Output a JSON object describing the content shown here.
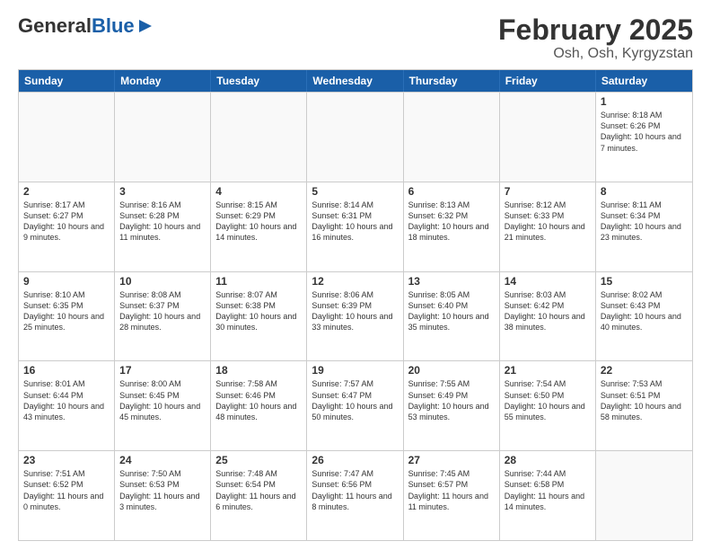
{
  "logo": {
    "general": "General",
    "blue": "Blue"
  },
  "title": "February 2025",
  "subtitle": "Osh, Osh, Kyrgyzstan",
  "weekdays": [
    "Sunday",
    "Monday",
    "Tuesday",
    "Wednesday",
    "Thursday",
    "Friday",
    "Saturday"
  ],
  "weeks": [
    [
      {
        "day": "",
        "info": ""
      },
      {
        "day": "",
        "info": ""
      },
      {
        "day": "",
        "info": ""
      },
      {
        "day": "",
        "info": ""
      },
      {
        "day": "",
        "info": ""
      },
      {
        "day": "",
        "info": ""
      },
      {
        "day": "1",
        "info": "Sunrise: 8:18 AM\nSunset: 6:26 PM\nDaylight: 10 hours and 7 minutes."
      }
    ],
    [
      {
        "day": "2",
        "info": "Sunrise: 8:17 AM\nSunset: 6:27 PM\nDaylight: 10 hours and 9 minutes."
      },
      {
        "day": "3",
        "info": "Sunrise: 8:16 AM\nSunset: 6:28 PM\nDaylight: 10 hours and 11 minutes."
      },
      {
        "day": "4",
        "info": "Sunrise: 8:15 AM\nSunset: 6:29 PM\nDaylight: 10 hours and 14 minutes."
      },
      {
        "day": "5",
        "info": "Sunrise: 8:14 AM\nSunset: 6:31 PM\nDaylight: 10 hours and 16 minutes."
      },
      {
        "day": "6",
        "info": "Sunrise: 8:13 AM\nSunset: 6:32 PM\nDaylight: 10 hours and 18 minutes."
      },
      {
        "day": "7",
        "info": "Sunrise: 8:12 AM\nSunset: 6:33 PM\nDaylight: 10 hours and 21 minutes."
      },
      {
        "day": "8",
        "info": "Sunrise: 8:11 AM\nSunset: 6:34 PM\nDaylight: 10 hours and 23 minutes."
      }
    ],
    [
      {
        "day": "9",
        "info": "Sunrise: 8:10 AM\nSunset: 6:35 PM\nDaylight: 10 hours and 25 minutes."
      },
      {
        "day": "10",
        "info": "Sunrise: 8:08 AM\nSunset: 6:37 PM\nDaylight: 10 hours and 28 minutes."
      },
      {
        "day": "11",
        "info": "Sunrise: 8:07 AM\nSunset: 6:38 PM\nDaylight: 10 hours and 30 minutes."
      },
      {
        "day": "12",
        "info": "Sunrise: 8:06 AM\nSunset: 6:39 PM\nDaylight: 10 hours and 33 minutes."
      },
      {
        "day": "13",
        "info": "Sunrise: 8:05 AM\nSunset: 6:40 PM\nDaylight: 10 hours and 35 minutes."
      },
      {
        "day": "14",
        "info": "Sunrise: 8:03 AM\nSunset: 6:42 PM\nDaylight: 10 hours and 38 minutes."
      },
      {
        "day": "15",
        "info": "Sunrise: 8:02 AM\nSunset: 6:43 PM\nDaylight: 10 hours and 40 minutes."
      }
    ],
    [
      {
        "day": "16",
        "info": "Sunrise: 8:01 AM\nSunset: 6:44 PM\nDaylight: 10 hours and 43 minutes."
      },
      {
        "day": "17",
        "info": "Sunrise: 8:00 AM\nSunset: 6:45 PM\nDaylight: 10 hours and 45 minutes."
      },
      {
        "day": "18",
        "info": "Sunrise: 7:58 AM\nSunset: 6:46 PM\nDaylight: 10 hours and 48 minutes."
      },
      {
        "day": "19",
        "info": "Sunrise: 7:57 AM\nSunset: 6:47 PM\nDaylight: 10 hours and 50 minutes."
      },
      {
        "day": "20",
        "info": "Sunrise: 7:55 AM\nSunset: 6:49 PM\nDaylight: 10 hours and 53 minutes."
      },
      {
        "day": "21",
        "info": "Sunrise: 7:54 AM\nSunset: 6:50 PM\nDaylight: 10 hours and 55 minutes."
      },
      {
        "day": "22",
        "info": "Sunrise: 7:53 AM\nSunset: 6:51 PM\nDaylight: 10 hours and 58 minutes."
      }
    ],
    [
      {
        "day": "23",
        "info": "Sunrise: 7:51 AM\nSunset: 6:52 PM\nDaylight: 11 hours and 0 minutes."
      },
      {
        "day": "24",
        "info": "Sunrise: 7:50 AM\nSunset: 6:53 PM\nDaylight: 11 hours and 3 minutes."
      },
      {
        "day": "25",
        "info": "Sunrise: 7:48 AM\nSunset: 6:54 PM\nDaylight: 11 hours and 6 minutes."
      },
      {
        "day": "26",
        "info": "Sunrise: 7:47 AM\nSunset: 6:56 PM\nDaylight: 11 hours and 8 minutes."
      },
      {
        "day": "27",
        "info": "Sunrise: 7:45 AM\nSunset: 6:57 PM\nDaylight: 11 hours and 11 minutes."
      },
      {
        "day": "28",
        "info": "Sunrise: 7:44 AM\nSunset: 6:58 PM\nDaylight: 11 hours and 14 minutes."
      },
      {
        "day": "",
        "info": ""
      }
    ]
  ]
}
